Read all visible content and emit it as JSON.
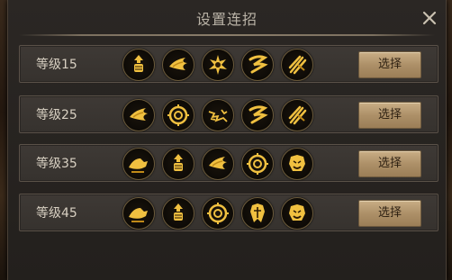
{
  "dialog": {
    "title": "设置连招",
    "choose_label": "选择",
    "rows": [
      {
        "level": "等级15",
        "skills": [
          "fist-up-icon",
          "flame-dash-icon",
          "shatter-icon",
          "double-slash-icon",
          "claw-strike-icon"
        ]
      },
      {
        "level": "等级25",
        "skills": [
          "flame-dash-icon",
          "vortex-icon",
          "crack-icon",
          "double-slash-icon",
          "claw-strike-icon"
        ]
      },
      {
        "level": "等级35",
        "skills": [
          "charge-icon",
          "fist-up-icon",
          "flame-dash-icon",
          "vortex-icon",
          "roar-icon"
        ]
      },
      {
        "level": "等级45",
        "skills": [
          "charge-icon",
          "fist-up-icon",
          "vortex-icon",
          "guard-icon",
          "roar-icon"
        ]
      }
    ]
  },
  "colors": {
    "accent_gold": "#f0c040",
    "button_bg": "#b89a72"
  }
}
